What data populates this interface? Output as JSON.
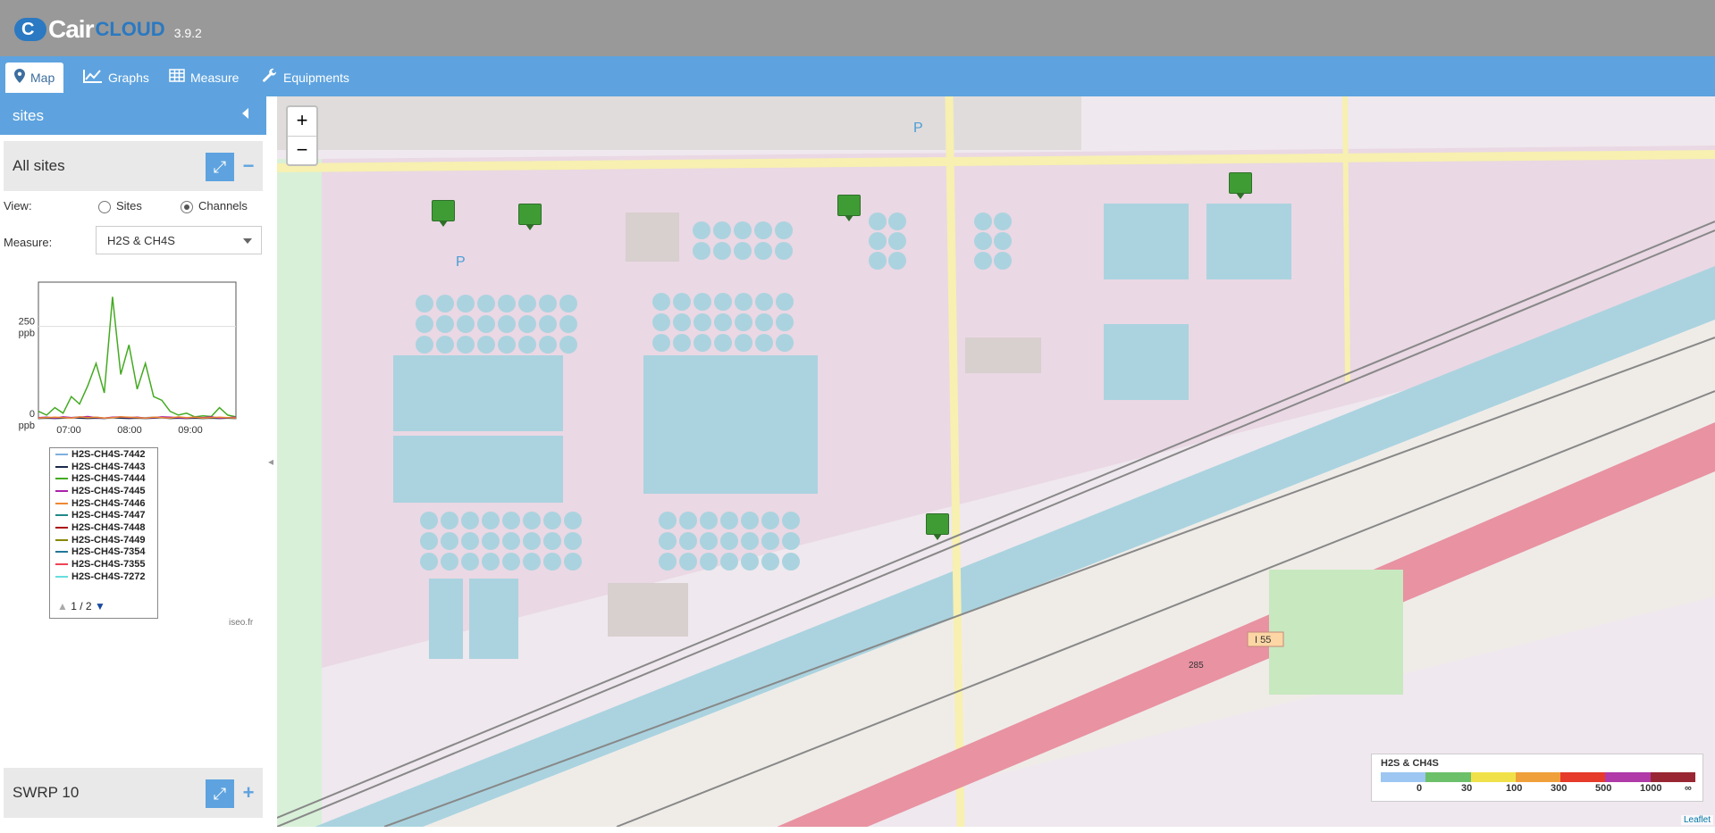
{
  "app": {
    "name_main": "Cair",
    "name_cloud": "CLOUD",
    "version": "3.9.2"
  },
  "nav": {
    "tabs": [
      {
        "label": "Map",
        "icon": "map-pin-icon"
      },
      {
        "label": "Graphs",
        "icon": "line-chart-icon"
      },
      {
        "label": "Measure",
        "icon": "table-icon"
      },
      {
        "label": "Equipments",
        "icon": "wrench-icon"
      }
    ]
  },
  "sidebar": {
    "title": "sites",
    "group1": {
      "name": "All sites",
      "expand_icon": "expand-icon",
      "toggle": "−"
    },
    "view": {
      "label": "View:",
      "options": [
        "Sites",
        "Channels"
      ],
      "selected": "Channels"
    },
    "measure": {
      "label": "Measure:",
      "value": "H2S & CH4S"
    },
    "group2": {
      "name": "SWRP 10",
      "toggle": "+"
    },
    "credit": "iseo.fr"
  },
  "chart_data": {
    "type": "line",
    "ylabel_top": "250\nppb",
    "yticks": [
      {
        "value": 250,
        "label": "250"
      },
      {
        "value": 0,
        "label": "0"
      }
    ],
    "yunit": "ppb",
    "ylim": [
      0,
      370
    ],
    "xticks": [
      "07:00",
      "08:00",
      "09:00"
    ],
    "xlim_hours": [
      6.5,
      9.75
    ],
    "series": [
      {
        "name": "H2S-CH4S-7442",
        "color": "#7fb0e0",
        "values": [
          2,
          3,
          2,
          4,
          3,
          5,
          3,
          4,
          2,
          3,
          4,
          3,
          2,
          3,
          4,
          3,
          2,
          3,
          2,
          4,
          3,
          2,
          3,
          2,
          3
        ]
      },
      {
        "name": "H2S-CH4S-7443",
        "color": "#1a2a4a",
        "values": [
          1,
          2,
          1,
          2,
          3,
          2,
          1,
          2,
          1,
          3,
          2,
          1,
          2,
          1,
          2,
          3,
          1,
          2,
          1,
          2,
          1,
          2,
          1,
          2,
          1
        ]
      },
      {
        "name": "H2S-CH4S-7444",
        "color": "#44aa22",
        "values": [
          20,
          10,
          30,
          15,
          60,
          40,
          90,
          150,
          70,
          330,
          120,
          200,
          80,
          150,
          60,
          50,
          20,
          10,
          15,
          5,
          8,
          6,
          30,
          10,
          5
        ]
      },
      {
        "name": "H2S-CH4S-7445",
        "color": "#aa22aa",
        "values": [
          3,
          4,
          2,
          5,
          3,
          4,
          6,
          3,
          2,
          4,
          5,
          3,
          4,
          2,
          3,
          5,
          4,
          3,
          2,
          4,
          3,
          5,
          2,
          3,
          4
        ]
      },
      {
        "name": "H2S-CH4S-7446",
        "color": "#ee8833",
        "values": [
          2,
          3,
          4,
          3,
          2,
          5,
          3,
          4,
          2,
          3,
          5,
          4,
          3,
          2,
          4,
          3,
          2,
          5,
          3,
          4,
          2,
          3,
          4,
          3,
          2
        ]
      }
    ],
    "legend_entries": [
      {
        "label": "H2S-CH4S-7442",
        "color": "#7fb0e0"
      },
      {
        "label": "H2S-CH4S-7443",
        "color": "#1a2a4a"
      },
      {
        "label": "H2S-CH4S-7444",
        "color": "#44aa22"
      },
      {
        "label": "H2S-CH4S-7445",
        "color": "#aa22aa"
      },
      {
        "label": "H2S-CH4S-7446",
        "color": "#ee8833"
      },
      {
        "label": "H2S-CH4S-7447",
        "color": "#228888"
      },
      {
        "label": "H2S-CH4S-7448",
        "color": "#aa1111"
      },
      {
        "label": "H2S-CH4S-7449",
        "color": "#888800"
      },
      {
        "label": "H2S-CH4S-7354",
        "color": "#227799"
      },
      {
        "label": "H2S-CH4S-7355",
        "color": "#ee4455"
      },
      {
        "label": "H2S-CH4S-7272",
        "color": "#66dddd"
      }
    ],
    "legend_page": "1 / 2"
  },
  "map": {
    "zoom_in": "+",
    "zoom_out": "−",
    "labels": [
      {
        "text": "P"
      },
      {
        "text": "P"
      },
      {
        "text": "I 55"
      },
      {
        "text": "285"
      }
    ],
    "legend": {
      "title": "H2S & CH4S",
      "colors": [
        "#9dc6f2",
        "#6cc06a",
        "#f0e14a",
        "#f0a03a",
        "#e63a2a",
        "#b03aa8",
        "#992733"
      ],
      "ticks": [
        "0",
        "30",
        "100",
        "300",
        "500",
        "1000",
        "∞"
      ]
    },
    "attribution": "Leaflet"
  }
}
